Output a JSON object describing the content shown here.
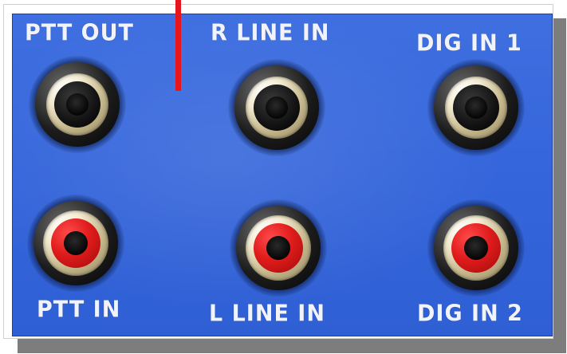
{
  "labels": {
    "ptt_out": "PTT OUT",
    "r_line_in": "R LINE IN",
    "dig_in_1": "DIG IN 1",
    "ptt_in": "PTT IN",
    "l_line_in": "L LINE IN",
    "dig_in_2": "DIG IN 2"
  },
  "colors": {
    "panel": "#3566db",
    "label_text": "#f1f3f8",
    "red_marker": "#e6161c",
    "red_insert": "#e01c1c"
  }
}
